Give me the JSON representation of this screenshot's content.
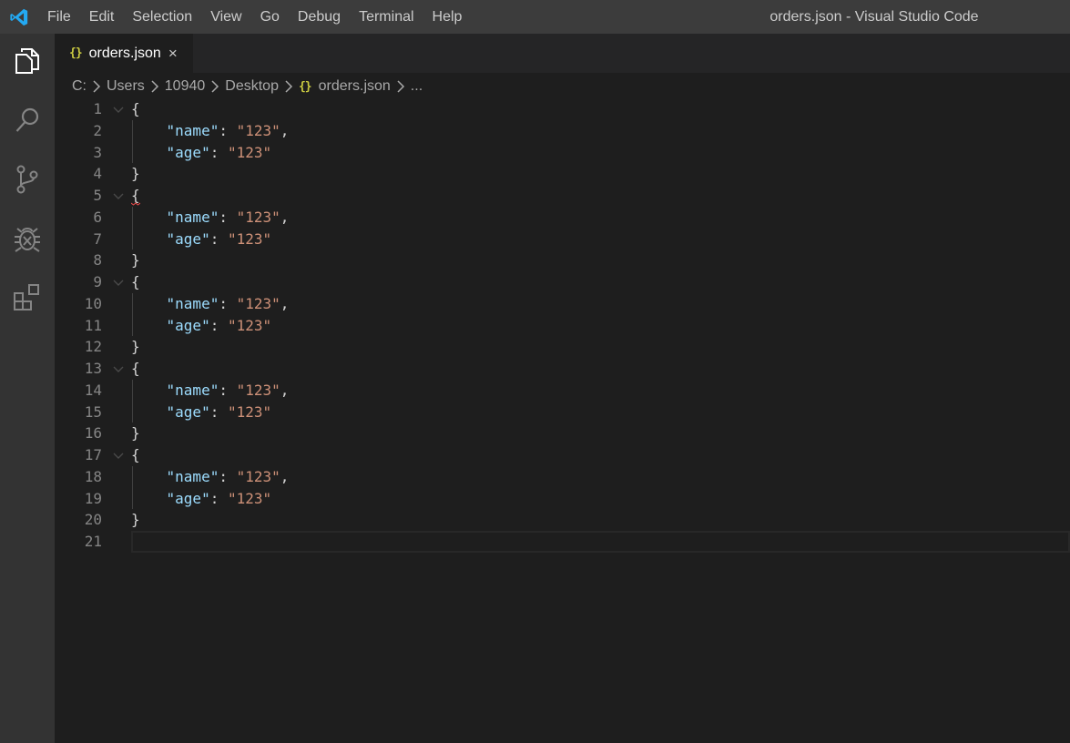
{
  "title_bar": {
    "menu": [
      "File",
      "Edit",
      "Selection",
      "View",
      "Go",
      "Debug",
      "Terminal",
      "Help"
    ],
    "window_title": "orders.json - Visual Studio Code"
  },
  "activity_bar": {
    "icons": [
      "explorer-icon",
      "search-icon",
      "source-control-icon",
      "debug-icon",
      "extensions-icon"
    ]
  },
  "tab": {
    "icon": "{}",
    "label": "orders.json",
    "close": "×"
  },
  "breadcrumbs": {
    "items": [
      "C:",
      "Users",
      "10940",
      "Desktop"
    ],
    "file_icon": "{}",
    "file": "orders.json",
    "tail": "..."
  },
  "editor": {
    "lines": [
      {
        "n": "1",
        "fold": true,
        "tokens": [
          [
            "p",
            "{"
          ]
        ]
      },
      {
        "n": "2",
        "fold": false,
        "tokens": [
          [
            "p",
            "    "
          ],
          [
            "k",
            "\"name\""
          ],
          [
            "p",
            ": "
          ],
          [
            "s",
            "\"123\""
          ],
          [
            "p",
            ","
          ]
        ]
      },
      {
        "n": "3",
        "fold": false,
        "tokens": [
          [
            "p",
            "    "
          ],
          [
            "k",
            "\"age\""
          ],
          [
            "p",
            ": "
          ],
          [
            "s",
            "\"123\""
          ]
        ]
      },
      {
        "n": "4",
        "fold": false,
        "tokens": [
          [
            "p",
            "}"
          ]
        ]
      },
      {
        "n": "5",
        "fold": true,
        "tokens": [
          [
            "p",
            "{"
          ]
        ]
      },
      {
        "n": "6",
        "fold": false,
        "tokens": [
          [
            "p",
            "    "
          ],
          [
            "k",
            "\"name\""
          ],
          [
            "p",
            ": "
          ],
          [
            "s",
            "\"123\""
          ],
          [
            "p",
            ","
          ]
        ]
      },
      {
        "n": "7",
        "fold": false,
        "tokens": [
          [
            "p",
            "    "
          ],
          [
            "k",
            "\"age\""
          ],
          [
            "p",
            ": "
          ],
          [
            "s",
            "\"123\""
          ]
        ]
      },
      {
        "n": "8",
        "fold": false,
        "tokens": [
          [
            "p",
            "}"
          ]
        ]
      },
      {
        "n": "9",
        "fold": true,
        "tokens": [
          [
            "p",
            "{"
          ]
        ]
      },
      {
        "n": "10",
        "fold": false,
        "tokens": [
          [
            "p",
            "    "
          ],
          [
            "k",
            "\"name\""
          ],
          [
            "p",
            ": "
          ],
          [
            "s",
            "\"123\""
          ],
          [
            "p",
            ","
          ]
        ]
      },
      {
        "n": "11",
        "fold": false,
        "tokens": [
          [
            "p",
            "    "
          ],
          [
            "k",
            "\"age\""
          ],
          [
            "p",
            ": "
          ],
          [
            "s",
            "\"123\""
          ]
        ]
      },
      {
        "n": "12",
        "fold": false,
        "tokens": [
          [
            "p",
            "}"
          ]
        ]
      },
      {
        "n": "13",
        "fold": true,
        "tokens": [
          [
            "p",
            "{"
          ]
        ]
      },
      {
        "n": "14",
        "fold": false,
        "tokens": [
          [
            "p",
            "    "
          ],
          [
            "k",
            "\"name\""
          ],
          [
            "p",
            ": "
          ],
          [
            "s",
            "\"123\""
          ],
          [
            "p",
            ","
          ]
        ]
      },
      {
        "n": "15",
        "fold": false,
        "tokens": [
          [
            "p",
            "    "
          ],
          [
            "k",
            "\"age\""
          ],
          [
            "p",
            ": "
          ],
          [
            "s",
            "\"123\""
          ]
        ]
      },
      {
        "n": "16",
        "fold": false,
        "tokens": [
          [
            "p",
            "}"
          ]
        ]
      },
      {
        "n": "17",
        "fold": true,
        "tokens": [
          [
            "p",
            "{"
          ]
        ]
      },
      {
        "n": "18",
        "fold": false,
        "tokens": [
          [
            "p",
            "    "
          ],
          [
            "k",
            "\"name\""
          ],
          [
            "p",
            ": "
          ],
          [
            "s",
            "\"123\""
          ],
          [
            "p",
            ","
          ]
        ]
      },
      {
        "n": "19",
        "fold": false,
        "tokens": [
          [
            "p",
            "    "
          ],
          [
            "k",
            "\"age\""
          ],
          [
            "p",
            ": "
          ],
          [
            "s",
            "\"123\""
          ]
        ]
      },
      {
        "n": "20",
        "fold": false,
        "tokens": [
          [
            "p",
            "}"
          ]
        ]
      },
      {
        "n": "21",
        "fold": false,
        "tokens": []
      }
    ]
  },
  "colors": {
    "key": "#9cdcfe",
    "string": "#ce9178",
    "punctuation": "#d4d4d4",
    "line_number": "#858585",
    "accent": "#007acc"
  }
}
